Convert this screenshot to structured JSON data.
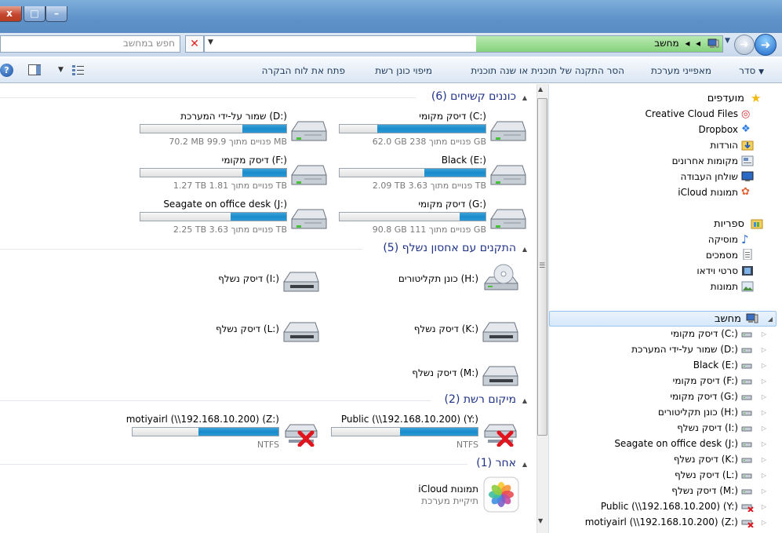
{
  "window": {
    "close_label": "x",
    "max_label": "□",
    "min_label": "–"
  },
  "address": {
    "search_placeholder": "חפש במחשב",
    "path_item": "מחשב",
    "path_sep": "◂",
    "clear_label": "✕"
  },
  "toolbar": {
    "organize": "סדר",
    "system_properties": "מאפייני מערכת",
    "uninstall": "הסר התקנה של תוכנית או שנה תוכנית",
    "map_drive": "מיפוי כונן רשת",
    "control_panel": "פתח את לוח הבקרה",
    "help": "?"
  },
  "groups": {
    "hard_drives": "כוננים קשיחים (6)",
    "removable": "התקנים עם אחסון נשלף (5)",
    "network": "מיקום רשת (2)",
    "other": "אחר (1)"
  },
  "hard_drives": [
    {
      "name": "דיסק מקומי (C:)",
      "free": "62.0 GB פנויים מתוך 238 GB",
      "used_pct": 74
    },
    {
      "name": "שמור על-ידי המערכת (D:)",
      "free": "70.2 MB פנויים מתוך 99.9 MB",
      "used_pct": 30
    },
    {
      "name": "Black (E:)",
      "free": "2.09 TB פנויים מתוך 3.63 TB",
      "used_pct": 42
    },
    {
      "name": "דיסק מקומי (F:)",
      "free": "1.27 TB פנויים מתוך 1.81 TB",
      "used_pct": 30
    },
    {
      "name": "דיסק מקומי (G:)",
      "free": "90.8 GB פנויים מתוך 111 GB",
      "used_pct": 18
    },
    {
      "name": "Seagate on office desk (J:)",
      "free": "2.25 TB פנויים מתוך 3.63 TB",
      "used_pct": 38
    }
  ],
  "removable": [
    {
      "name": "כונן תקליטורים (H:)"
    },
    {
      "name": "דיסק נשלף (I:)"
    },
    {
      "name": "דיסק נשלף (K:)"
    },
    {
      "name": "דיסק נשלף (L:)"
    },
    {
      "name": "דיסק נשלף (M:)"
    }
  ],
  "network": [
    {
      "name": "Public (\\\\192.168.10.200) (Y:)",
      "fs": "NTFS",
      "used_pct": 53
    },
    {
      "name": "motiyairl (\\\\192.168.10.200) (Z:)",
      "fs": "NTFS",
      "used_pct": 55
    }
  ],
  "other": {
    "name": "iCloud תמונות",
    "sub": "תיקיית מערכת"
  },
  "nav": {
    "favorites": "מועדפים",
    "favorite_items": [
      "Creative Cloud Files",
      "Dropbox",
      "הורדות",
      "מקומות אחרונים",
      "שולחן העבודה",
      "iCloud תמונות"
    ],
    "libraries": "ספריות",
    "library_items": [
      "מוסיקה",
      "מסמכים",
      "סרטי וידאו",
      "תמונות"
    ],
    "computer": "מחשב",
    "computer_items": [
      "דיסק מקומי (C:)",
      "שמור על-ידי המערכת (D:)",
      "Black (E:)",
      "דיסק מקומי (F:)",
      "דיסק מקומי (G:)",
      "כונן תקליטורים (H:)",
      "דיסק נשלף (I:)",
      "Seagate on office desk (J:)",
      "דיסק נשלף (K:)",
      "דיסק נשלף (L:)",
      "דיסק נשלף (M:)",
      "Public (\\\\192.168.10.200) (Y:)",
      "motiyairl (\\\\192.168.10.200) (Z:)"
    ]
  },
  "colors": {
    "group_title": "#1e3287",
    "bar_fill": "#1a8ccb",
    "address_progress": "#86d37c"
  }
}
